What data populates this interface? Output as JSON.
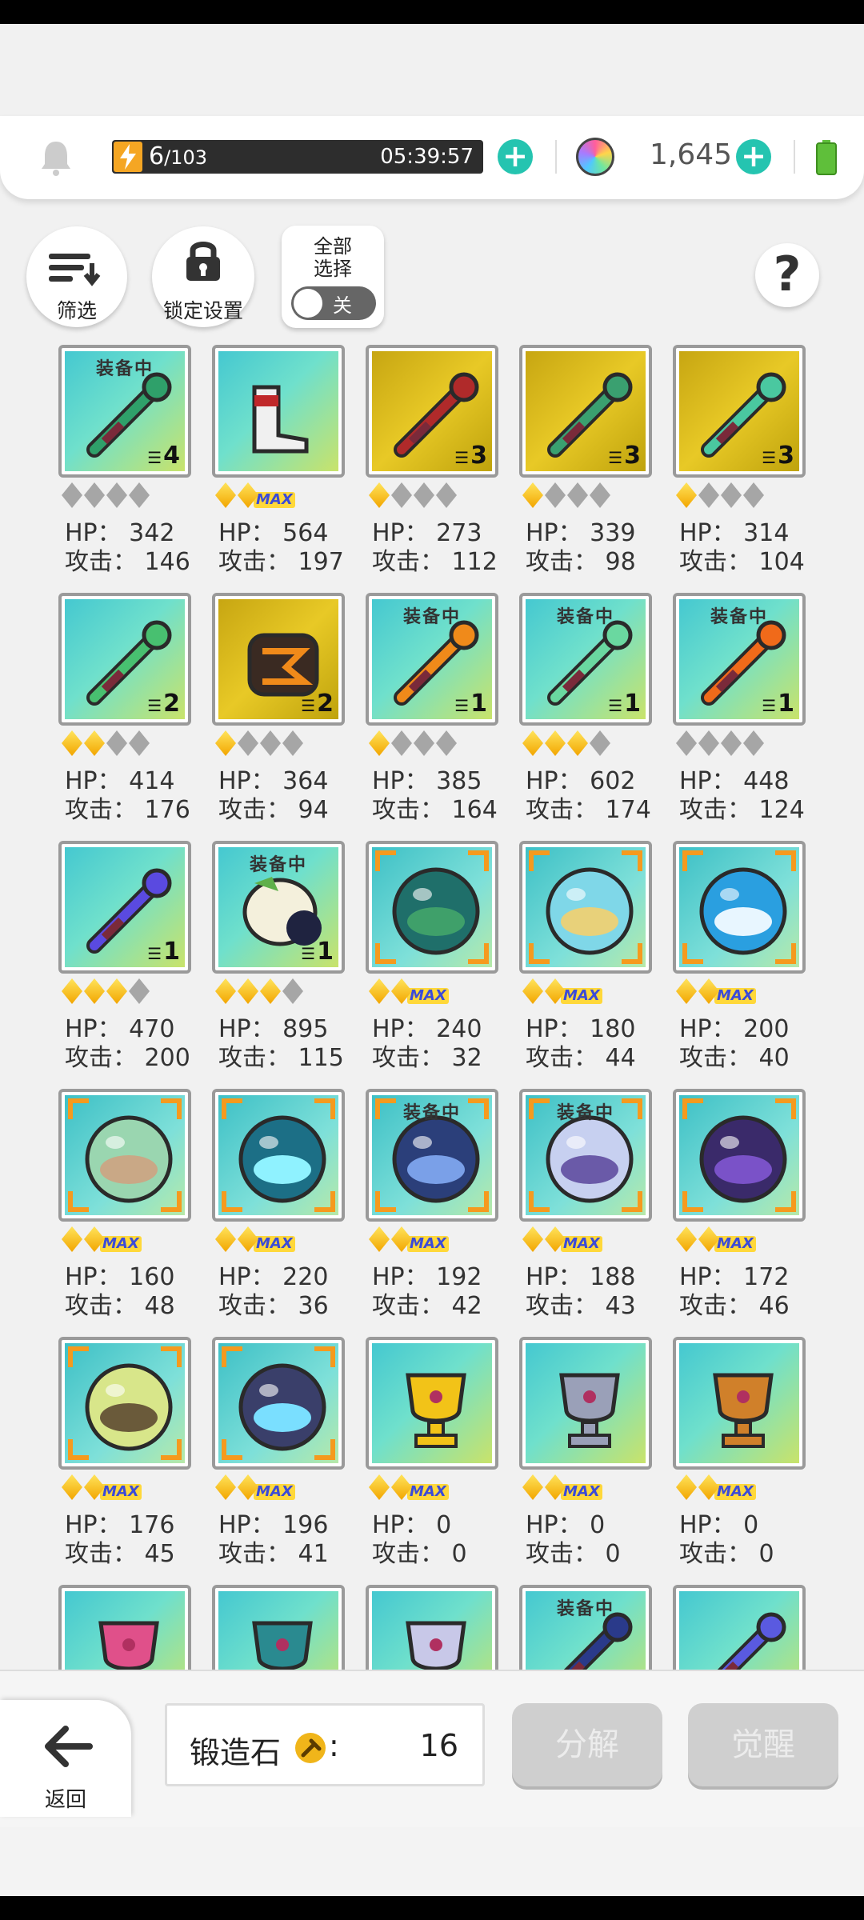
{
  "header": {
    "energy_current": "6",
    "energy_max": "/103",
    "energy_timer": "05:39:57",
    "gems": "1,645"
  },
  "controls": {
    "filter_label": "筛选",
    "lock_label": "锁定设置",
    "select_all_label": "全部\n选择",
    "toggle_label": "关"
  },
  "equipped_label": "装备中",
  "items": [
    {
      "stars": 0,
      "max": false,
      "count": "4",
      "equipped": true,
      "hp": "HP： 342",
      "atk": "攻击： 146",
      "bg": "teal",
      "icon": "green-sword-icon"
    },
    {
      "stars": 2,
      "max": true,
      "count": "",
      "equipped": false,
      "hp": "HP： 564",
      "atk": "攻击： 197",
      "bg": "teal",
      "icon": "boots-icon"
    },
    {
      "stars": 1,
      "max": false,
      "count": "3",
      "equipped": false,
      "hp": "HP： 273",
      "atk": "攻击： 112",
      "bg": "gold",
      "icon": "red-cannon-icon"
    },
    {
      "stars": 1,
      "max": false,
      "count": "3",
      "equipped": false,
      "hp": "HP： 339",
      "atk": "攻击： 98",
      "bg": "gold",
      "icon": "green-bow-icon"
    },
    {
      "stars": 1,
      "max": false,
      "count": "3",
      "equipped": false,
      "hp": "HP： 314",
      "atk": "攻击： 104",
      "bg": "gold",
      "icon": "jade-staff-icon"
    },
    {
      "stars": 2,
      "max": false,
      "count": "2",
      "equipped": false,
      "hp": "HP： 414",
      "atk": "攻击： 176",
      "bg": "teal",
      "icon": "green-scythe-icon"
    },
    {
      "stars": 1,
      "max": false,
      "count": "2",
      "equipped": false,
      "hp": "HP： 364",
      "atk": "攻击： 94",
      "bg": "gold",
      "icon": "gauntlet-icon"
    },
    {
      "stars": 1,
      "max": false,
      "count": "1",
      "equipped": true,
      "hp": "HP： 385",
      "atk": "攻击： 164",
      "bg": "teal",
      "icon": "hammer-icon"
    },
    {
      "stars": 3,
      "max": false,
      "count": "1",
      "equipped": true,
      "hp": "HP： 602",
      "atk": "攻击： 174",
      "bg": "teal",
      "icon": "green-mace-icon"
    },
    {
      "stars": 0,
      "max": false,
      "count": "1",
      "equipped": true,
      "hp": "HP： 448",
      "atk": "攻击： 124",
      "bg": "teal",
      "icon": "fire-staff-icon"
    },
    {
      "stars": 3,
      "max": false,
      "count": "1",
      "equipped": false,
      "hp": "HP： 470",
      "atk": "攻击： 200",
      "bg": "teal",
      "icon": "purple-whip-icon"
    },
    {
      "stars": 3,
      "max": false,
      "count": "1",
      "equipped": true,
      "hp": "HP： 895",
      "atk": "攻击： 115",
      "bg": "teal",
      "icon": "shield-icon"
    },
    {
      "stars": 2,
      "max": true,
      "count": "",
      "equipped": false,
      "hp": "HP： 240",
      "atk": "攻击： 32",
      "bg": "orb",
      "icon": "forest-orb-icon"
    },
    {
      "stars": 2,
      "max": true,
      "count": "",
      "equipped": false,
      "hp": "HP： 180",
      "atk": "攻击： 44",
      "bg": "orb",
      "icon": "desert-orb-icon"
    },
    {
      "stars": 2,
      "max": true,
      "count": "",
      "equipped": false,
      "hp": "HP： 200",
      "atk": "攻击： 40",
      "bg": "orb",
      "icon": "ocean-orb-icon"
    },
    {
      "stars": 2,
      "max": true,
      "count": "",
      "equipped": false,
      "hp": "HP： 160",
      "atk": "攻击： 48",
      "bg": "orb",
      "icon": "rock-orb-icon"
    },
    {
      "stars": 2,
      "max": true,
      "count": "",
      "equipped": false,
      "hp": "HP： 220",
      "atk": "攻击： 36",
      "bg": "orb",
      "icon": "crystal-orb-icon"
    },
    {
      "stars": 2,
      "max": true,
      "count": "",
      "equipped": true,
      "hp": "HP： 192",
      "atk": "攻击： 42",
      "bg": "orb",
      "icon": "night-orb-icon"
    },
    {
      "stars": 2,
      "max": true,
      "count": "",
      "equipped": true,
      "hp": "HP： 188",
      "atk": "攻击： 43",
      "bg": "orb",
      "icon": "storm-orb-icon"
    },
    {
      "stars": 2,
      "max": true,
      "count": "",
      "equipped": false,
      "hp": "HP： 172",
      "atk": "攻击： 46",
      "bg": "orb",
      "icon": "shadow-orb-icon"
    },
    {
      "stars": 2,
      "max": true,
      "count": "",
      "equipped": false,
      "hp": "HP： 176",
      "atk": "攻击： 45",
      "bg": "orb",
      "icon": "swamp-orb-icon"
    },
    {
      "stars": 2,
      "max": true,
      "count": "",
      "equipped": false,
      "hp": "HP： 196",
      "atk": "攻击： 41",
      "bg": "orb",
      "icon": "star-orb-icon"
    },
    {
      "stars": 2,
      "max": true,
      "count": "",
      "equipped": false,
      "hp": "HP： 0",
      "atk": "攻击： 0",
      "bg": "teal",
      "icon": "gold-trophy-icon"
    },
    {
      "stars": 2,
      "max": true,
      "count": "",
      "equipped": false,
      "hp": "HP： 0",
      "atk": "攻击： 0",
      "bg": "teal",
      "icon": "silver-trophy-icon"
    },
    {
      "stars": 2,
      "max": true,
      "count": "",
      "equipped": false,
      "hp": "HP： 0",
      "atk": "攻击： 0",
      "bg": "teal",
      "icon": "bronze-trophy-icon"
    },
    {
      "stars": 0,
      "max": false,
      "count": "",
      "equipped": false,
      "hp": "",
      "atk": "",
      "bg": "teal",
      "icon": "pink-trophy-icon"
    },
    {
      "stars": 0,
      "max": false,
      "count": "",
      "equipped": false,
      "hp": "",
      "atk": "",
      "bg": "teal",
      "icon": "teal-trophy-icon"
    },
    {
      "stars": 0,
      "max": false,
      "count": "",
      "equipped": false,
      "hp": "",
      "atk": "",
      "bg": "teal",
      "icon": "crown-icon"
    },
    {
      "stars": 0,
      "max": false,
      "count": "",
      "equipped": true,
      "hp": "",
      "atk": "",
      "bg": "teal",
      "icon": "dark-blade-icon"
    },
    {
      "stars": 0,
      "max": false,
      "count": "",
      "equipped": false,
      "hp": "",
      "atk": "",
      "bg": "teal",
      "icon": "purple-sword-icon"
    }
  ],
  "bottom": {
    "back_label": "返回",
    "forge_label": "锻造石",
    "forge_colon": ":",
    "forge_value": "16",
    "decompose_label": "分解",
    "awaken_label": "觉醒"
  },
  "colors": {
    "accent_teal": "#25c4b0",
    "star_gold": "#f2a500",
    "frame_gray": "#9a9a9a",
    "orb_corner": "#f59a1e"
  }
}
